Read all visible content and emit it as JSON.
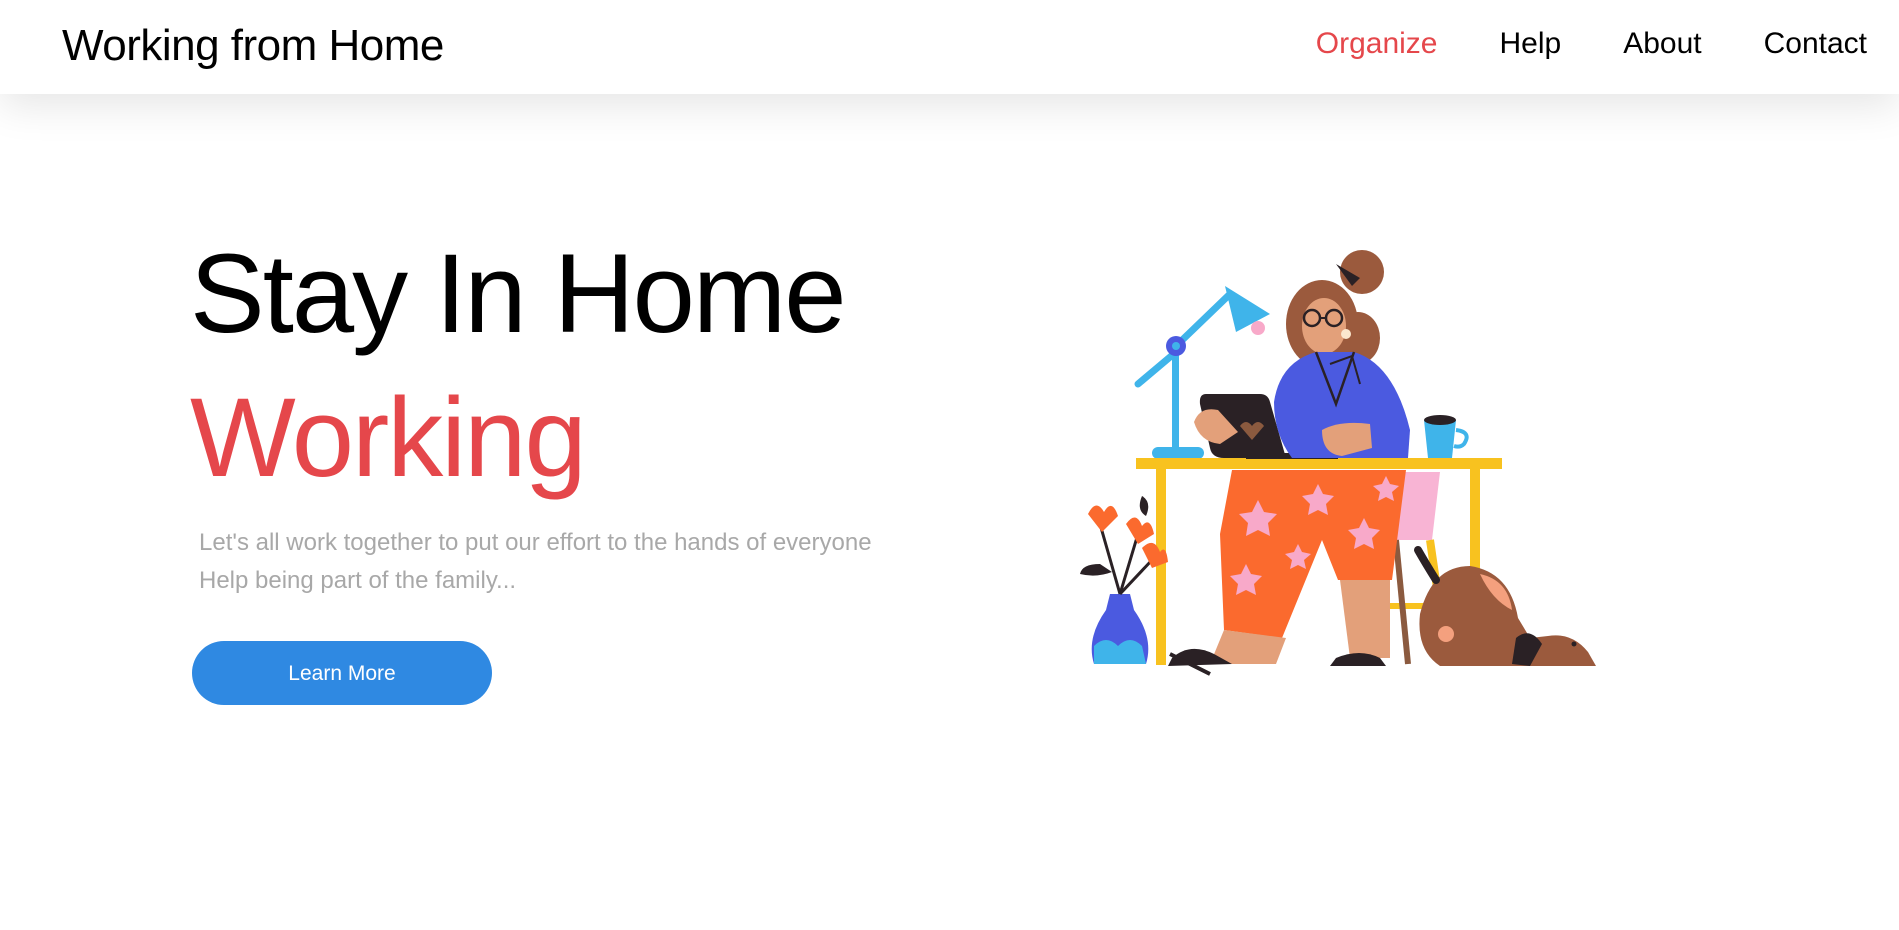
{
  "header": {
    "brand": "Working from Home",
    "nav": [
      {
        "label": "Organize",
        "active": true
      },
      {
        "label": "Help",
        "active": false
      },
      {
        "label": "About",
        "active": false
      },
      {
        "label": "Contact",
        "active": false
      }
    ]
  },
  "hero": {
    "title_line1": "Stay In Home",
    "title_line2": "Working",
    "subtitle_line1": "Let's all work together to put our effort to the hands of everyone",
    "subtitle_line2": "Help being part of the family...",
    "cta_label": "Learn More"
  },
  "colors": {
    "accent_red": "#e5474b",
    "button_blue": "#2f89e2",
    "subtitle_gray": "#a8a8a8"
  },
  "illustration": {
    "subject": "woman-working-at-desk-illustration"
  }
}
